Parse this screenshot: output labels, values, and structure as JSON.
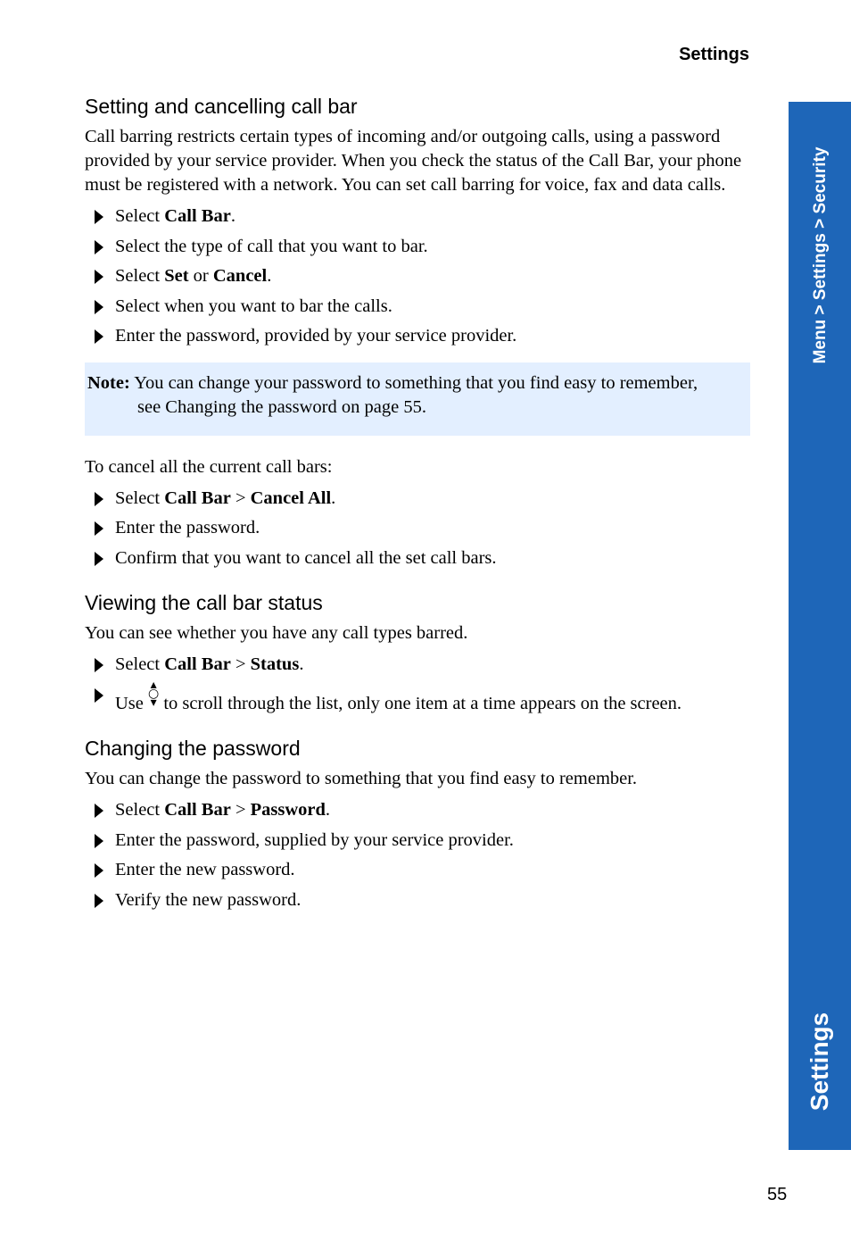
{
  "header": {
    "title": "Settings"
  },
  "sidebar_tab": {
    "breadcrumb": "Menu > Settings > Security",
    "section": "Settings",
    "color": "#1e66b8"
  },
  "page_number": "55",
  "section1": {
    "title": "Setting and cancelling call bar",
    "intro": "Call barring restricts certain types of incoming and/or outgoing calls, using a password provided by your service provider. When you check the status of the Call Bar, your phone must be registered with a network. You can set call barring for voice, fax and data calls.",
    "steps": [
      {
        "pre": "Select ",
        "b1": "Call Bar",
        "post": "."
      },
      {
        "text": "Select the type of call that you want to bar."
      },
      {
        "pre": "Select ",
        "b1": "Set",
        "mid": " or ",
        "b2": "Cancel",
        "post": "."
      },
      {
        "text": "Select when you want to bar the calls."
      },
      {
        "text": "Enter the password, provided by your service provider."
      }
    ],
    "note_label": "Note:",
    "note_line1": "You can change your password to something that you find easy to remember,",
    "note_line2": "see Changing the password on page 55.",
    "cancel_intro": "To cancel all the current call bars:",
    "cancel_steps": [
      {
        "pre": "Select ",
        "b1": "Call Bar",
        "mid": " > ",
        "b2": "Cancel All",
        "post": "."
      },
      {
        "text": "Enter the password."
      },
      {
        "text": "Confirm that you want to cancel all the set call bars."
      }
    ]
  },
  "section2": {
    "title": "Viewing the call bar status",
    "intro": "You can see whether you have any call types barred.",
    "steps": [
      {
        "pre": "Select ",
        "b1": "Call Bar",
        "mid": " > ",
        "b2": "Status",
        "post": "."
      },
      {
        "pre": "Use ",
        "post": " to scroll through the list, only one item at a time appears on the screen."
      }
    ]
  },
  "section3": {
    "title": "Changing the password",
    "intro": "You can change the password to something that you find easy to remember.",
    "steps": [
      {
        "pre": "Select ",
        "b1": "Call Bar",
        "mid": " > ",
        "b2": "Password",
        "post": "."
      },
      {
        "text": "Enter the password, supplied by your service provider."
      },
      {
        "text": "Enter the new password."
      },
      {
        "text": "Verify the new password."
      }
    ]
  }
}
